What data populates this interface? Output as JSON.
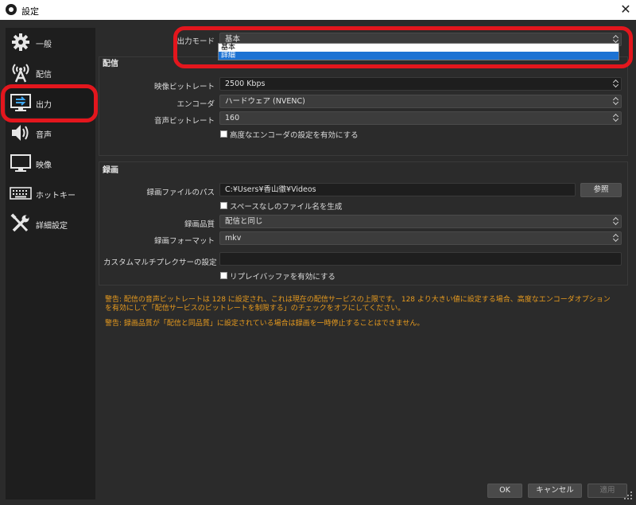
{
  "window": {
    "title": "設定",
    "close_glyph": "✕"
  },
  "sidebar": {
    "items": [
      {
        "label": "一般",
        "icon": "gear-icon"
      },
      {
        "label": "配信",
        "icon": "broadcast-icon"
      },
      {
        "label": "出力",
        "icon": "output-icon"
      },
      {
        "label": "音声",
        "icon": "speaker-icon"
      },
      {
        "label": "映像",
        "icon": "monitor-icon"
      },
      {
        "label": "ホットキー",
        "icon": "keyboard-icon"
      },
      {
        "label": "詳細設定",
        "icon": "tools-icon"
      }
    ],
    "active_index": 2
  },
  "output_mode": {
    "label": "出力モード",
    "value": "基本",
    "options": [
      "基本",
      "詳細"
    ],
    "highlighted_option": "詳細"
  },
  "streaming": {
    "title": "配信",
    "video_bitrate_label": "映像ビットレート",
    "video_bitrate_value": "2500 Kbps",
    "encoder_label": "エンコーダ",
    "encoder_value": "ハードウェア (NVENC)",
    "audio_bitrate_label": "音声ビットレート",
    "audio_bitrate_value": "160",
    "advanced_checkbox_label": "高度なエンコーダの設定を有効にする",
    "advanced_checked": false
  },
  "recording": {
    "title": "録画",
    "path_label": "録画ファイルのパス",
    "path_value": "C:¥Users¥香山徹¥Videos",
    "browse_label": "参照",
    "no_space_label": "スペースなしのファイル名を生成",
    "no_space_checked": false,
    "quality_label": "録画品質",
    "quality_value": "配信と同じ",
    "format_label": "録画フォーマット",
    "format_value": "mkv",
    "muxer_label": "カスタムマルチプレクサーの設定",
    "muxer_value": "",
    "replay_label": "リプレイバッファを有効にする",
    "replay_checked": false
  },
  "warnings": {
    "line1": "警告: 配信の音声ビットレートは 128 に設定され、これは現在の配信サービスの上限です。 128 より大きい値に設定する場合、高度なエンコーダオプション",
    "line2": "を有効にして「配信サービスのビットレートを制限する」のチェックをオフにしてください。",
    "line3": "警告: 録画品質が「配信と同品質」に設定されている場合は録画を一時停止することはできません。"
  },
  "footer": {
    "ok_label": "OK",
    "cancel_label": "キャンセル",
    "apply_label": "適用"
  },
  "colors": {
    "background": "#2b2b2b",
    "sidebar": "#1e1e1e",
    "warning": "#e89b1e",
    "highlight_annotation": "#e3161d",
    "dropdown_selection": "#1c72d3"
  }
}
